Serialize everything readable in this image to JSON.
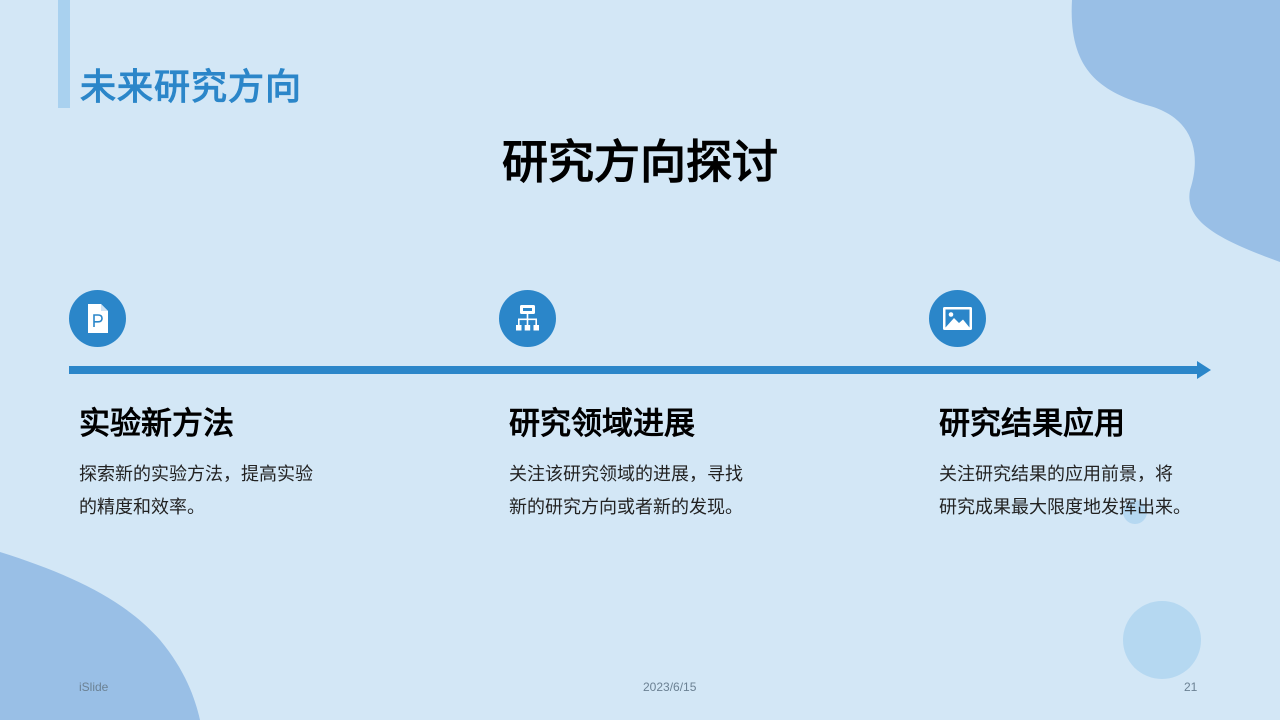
{
  "header": {
    "section_title": "未来研究方向",
    "main_title": "研究方向探讨"
  },
  "items": [
    {
      "icon": "ppt-file-icon",
      "title": "实验新方法",
      "desc_lines": [
        "探索新的实验方法，提高实验",
        "的精度和效率。"
      ]
    },
    {
      "icon": "org-chart-icon",
      "title": "研究领域进展",
      "desc_lines": [
        "关注该研究领域的进展，寻找",
        "新的研究方向或者新的发现。"
      ]
    },
    {
      "icon": "image-icon",
      "title": "研究结果应用",
      "desc_lines": [
        "关注研究结果的应用前景，将",
        "研究成果最大限度地发挥出来。"
      ]
    }
  ],
  "footer": {
    "brand": "iSlide",
    "date": "2023/6/15",
    "page_number": "21"
  },
  "colors": {
    "background": "#d3e7f6",
    "accent": "#2b86c9",
    "blob": "#99bfe6",
    "light_bar": "#a9d1ef"
  }
}
